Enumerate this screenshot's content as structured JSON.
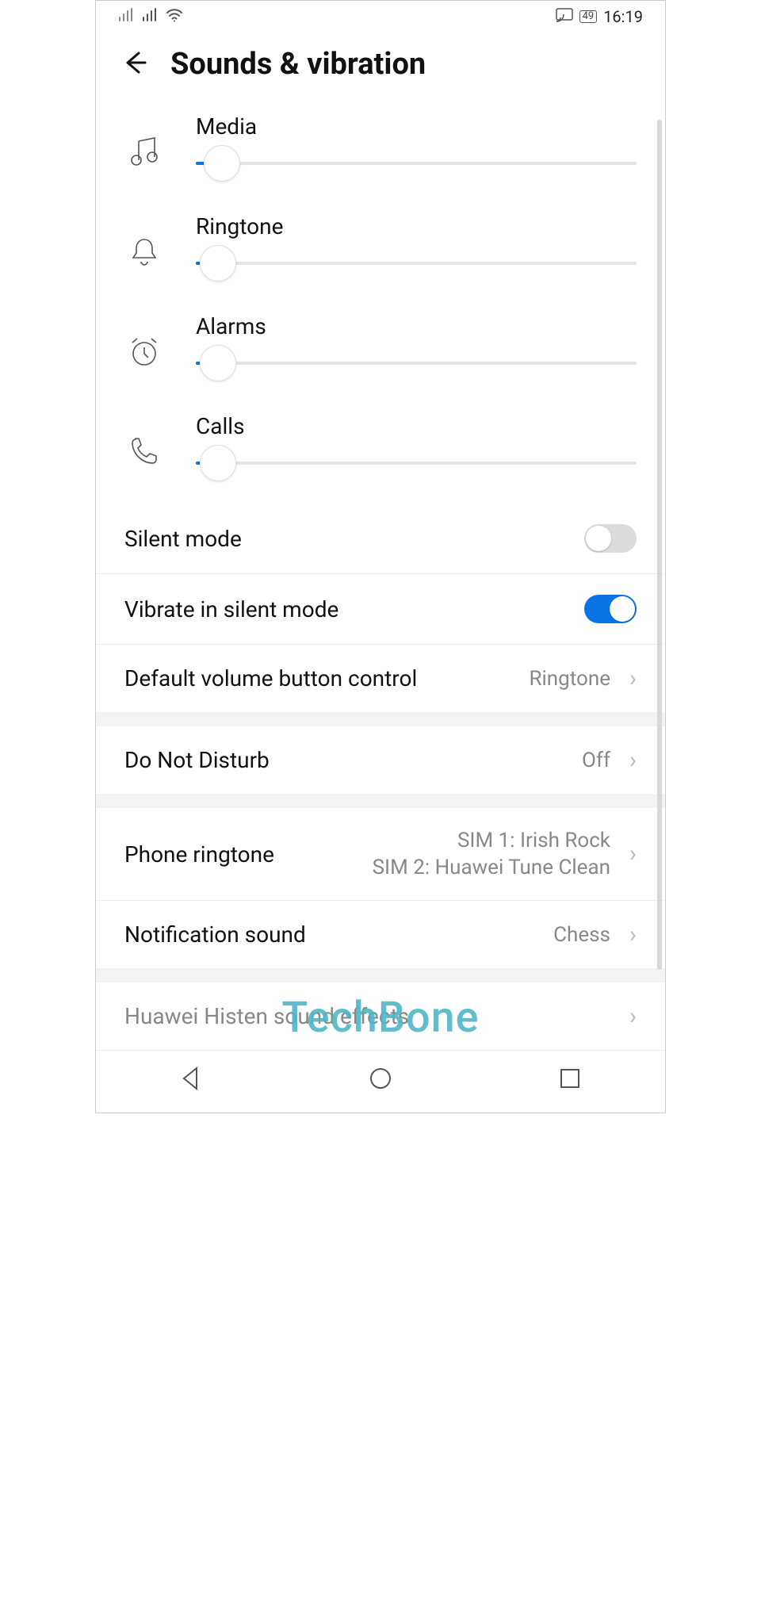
{
  "status": {
    "battery": "49",
    "time": "16:19"
  },
  "header": {
    "title": "Sounds & vibration"
  },
  "sliders": [
    {
      "label": "Media",
      "icon": "music-note-icon",
      "value_pct": 6
    },
    {
      "label": "Ringtone",
      "icon": "bell-icon",
      "value_pct": 5
    },
    {
      "label": "Alarms",
      "icon": "alarm-clock-icon",
      "value_pct": 5
    },
    {
      "label": "Calls",
      "icon": "phone-icon",
      "value_pct": 5
    }
  ],
  "rows": {
    "silent": {
      "label": "Silent mode",
      "on": false
    },
    "vibrate": {
      "label": "Vibrate in silent mode",
      "on": true
    },
    "volbtn": {
      "label": "Default volume button control",
      "value": "Ringtone"
    },
    "dnd": {
      "label": "Do Not Disturb",
      "value": "Off"
    },
    "ringtone": {
      "label": "Phone ringtone",
      "line1": "SIM 1: Irish Rock",
      "line2": "SIM 2: Huawei Tune Clean"
    },
    "notif": {
      "label": "Notification sound",
      "value": "Chess"
    },
    "histen": {
      "label": "Huawei Histen sound effects"
    }
  },
  "watermark": "TechBone"
}
